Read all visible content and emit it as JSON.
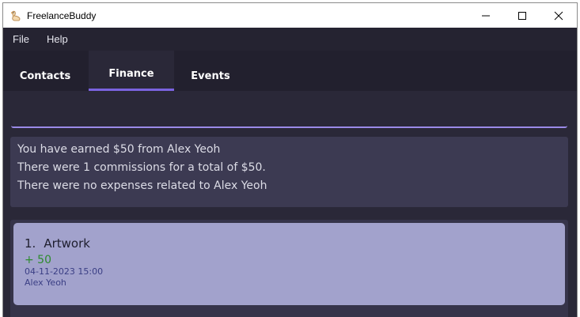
{
  "window": {
    "title": "FreelanceBuddy",
    "controls": [
      "minimize-icon",
      "maximize-icon",
      "close-icon"
    ]
  },
  "menu": {
    "items": [
      {
        "label": "File"
      },
      {
        "label": "Help"
      }
    ]
  },
  "tabs": [
    {
      "label": "Contacts",
      "active": false
    },
    {
      "label": "Finance",
      "active": true
    },
    {
      "label": "Events",
      "active": false
    }
  ],
  "command": {
    "value": ""
  },
  "result": {
    "lines": [
      "You have earned $50 from Alex Yeoh",
      "There were 1 commissions for a total of $50.",
      "There were no expenses related to Alex Yeoh"
    ]
  },
  "finance_list": {
    "items": [
      {
        "index": "1.",
        "title": "Artwork",
        "amount": "+ 50",
        "datetime": "04-11-2023 15:00",
        "client": "Alex Yeoh"
      }
    ]
  },
  "colors": {
    "accent": "#7a63e0",
    "income": "#2e8b2e",
    "card_bg": "#a2a2cc"
  }
}
